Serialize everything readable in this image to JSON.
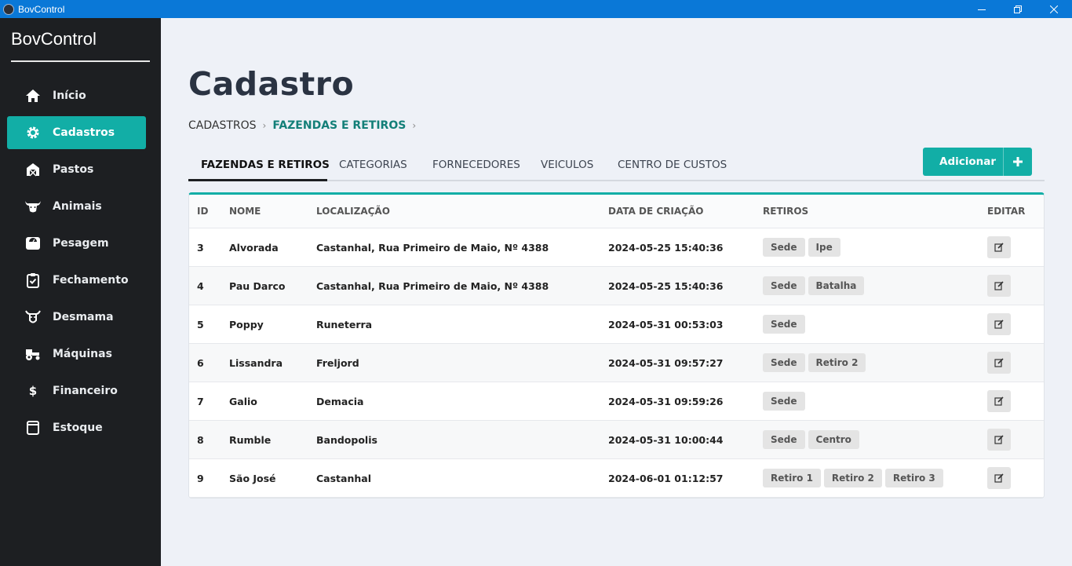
{
  "window": {
    "title": "BovControl"
  },
  "sidebar": {
    "brand": "BovControl",
    "items": [
      {
        "label": "Início",
        "icon": "home-icon",
        "active": false
      },
      {
        "label": "Cadastros",
        "icon": "gear-icon",
        "active": true
      },
      {
        "label": "Pastos",
        "icon": "barn-icon",
        "active": false
      },
      {
        "label": "Animais",
        "icon": "cow-head-icon",
        "active": false
      },
      {
        "label": "Pesagem",
        "icon": "scale-icon",
        "active": false
      },
      {
        "label": "Fechamento",
        "icon": "clipboard-check-icon",
        "active": false
      },
      {
        "label": "Desmama",
        "icon": "calf-icon",
        "active": false
      },
      {
        "label": "Máquinas",
        "icon": "tractor-icon",
        "active": false
      },
      {
        "label": "Financeiro",
        "icon": "dollar-icon",
        "active": false
      },
      {
        "label": "Estoque",
        "icon": "box-icon",
        "active": false
      }
    ]
  },
  "page": {
    "title": "Cadastro",
    "breadcrumb": [
      "CADASTROS",
      "FAZENDAS E RETIROS"
    ]
  },
  "tabs": [
    "FAZENDAS E RETIROS",
    "CATEGORIAS",
    "FORNECEDORES",
    "VEICULOS",
    "CENTRO DE CUSTOS"
  ],
  "add_button": {
    "label": "Adicionar"
  },
  "table": {
    "columns": [
      "ID",
      "NOME",
      "LOCALIZAÇÃO",
      "DATA DE CRIAÇÃO",
      "RETIROS",
      "EDITAR"
    ],
    "rows": [
      {
        "id": "3",
        "nome": "Alvorada",
        "loc": "Castanhal, Rua Primeiro de Maio, Nº 4388",
        "data": "2024-05-25 15:40:36",
        "retiros": [
          "Sede",
          "Ipe"
        ]
      },
      {
        "id": "4",
        "nome": "Pau Darco",
        "loc": "Castanhal, Rua Primeiro de Maio, Nº 4388",
        "data": "2024-05-25 15:40:36",
        "retiros": [
          "Sede",
          "Batalha"
        ]
      },
      {
        "id": "5",
        "nome": "Poppy",
        "loc": "Runeterra",
        "data": "2024-05-31 00:53:03",
        "retiros": [
          "Sede"
        ]
      },
      {
        "id": "6",
        "nome": "Lissandra",
        "loc": "Freljord",
        "data": "2024-05-31 09:57:27",
        "retiros": [
          "Sede",
          "Retiro 2"
        ]
      },
      {
        "id": "7",
        "nome": "Galio",
        "loc": "Demacia",
        "data": "2024-05-31 09:59:26",
        "retiros": [
          "Sede"
        ]
      },
      {
        "id": "8",
        "nome": "Rumble",
        "loc": "Bandopolis",
        "data": "2024-05-31 10:00:44",
        "retiros": [
          "Sede",
          "Centro"
        ]
      },
      {
        "id": "9",
        "nome": "São José",
        "loc": "Castanhal",
        "data": "2024-06-01 01:12:57",
        "retiros": [
          "Retiro 1",
          "Retiro 2",
          "Retiro 3"
        ]
      }
    ]
  },
  "colors": {
    "accent": "#12aea6",
    "sidebar": "#1d1f22",
    "titlebar": "#0a78d7",
    "breadcrumb_active": "#137f78"
  }
}
